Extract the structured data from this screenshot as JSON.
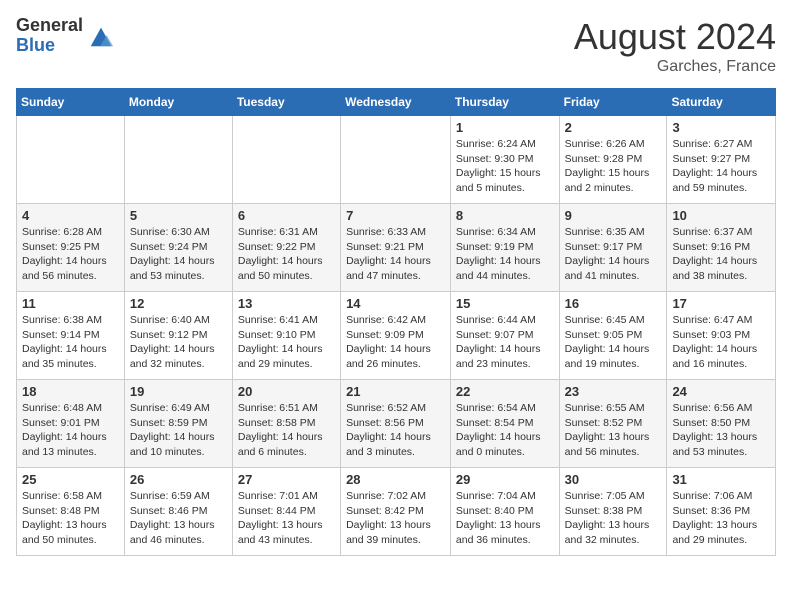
{
  "logo": {
    "general": "General",
    "blue": "Blue"
  },
  "title": "August 2024",
  "subtitle": "Garches, France",
  "days_of_week": [
    "Sunday",
    "Monday",
    "Tuesday",
    "Wednesday",
    "Thursday",
    "Friday",
    "Saturday"
  ],
  "weeks": [
    [
      {
        "day": "",
        "info": ""
      },
      {
        "day": "",
        "info": ""
      },
      {
        "day": "",
        "info": ""
      },
      {
        "day": "",
        "info": ""
      },
      {
        "day": "1",
        "info": "Sunrise: 6:24 AM\nSunset: 9:30 PM\nDaylight: 15 hours\nand 5 minutes."
      },
      {
        "day": "2",
        "info": "Sunrise: 6:26 AM\nSunset: 9:28 PM\nDaylight: 15 hours\nand 2 minutes."
      },
      {
        "day": "3",
        "info": "Sunrise: 6:27 AM\nSunset: 9:27 PM\nDaylight: 14 hours\nand 59 minutes."
      }
    ],
    [
      {
        "day": "4",
        "info": "Sunrise: 6:28 AM\nSunset: 9:25 PM\nDaylight: 14 hours\nand 56 minutes."
      },
      {
        "day": "5",
        "info": "Sunrise: 6:30 AM\nSunset: 9:24 PM\nDaylight: 14 hours\nand 53 minutes."
      },
      {
        "day": "6",
        "info": "Sunrise: 6:31 AM\nSunset: 9:22 PM\nDaylight: 14 hours\nand 50 minutes."
      },
      {
        "day": "7",
        "info": "Sunrise: 6:33 AM\nSunset: 9:21 PM\nDaylight: 14 hours\nand 47 minutes."
      },
      {
        "day": "8",
        "info": "Sunrise: 6:34 AM\nSunset: 9:19 PM\nDaylight: 14 hours\nand 44 minutes."
      },
      {
        "day": "9",
        "info": "Sunrise: 6:35 AM\nSunset: 9:17 PM\nDaylight: 14 hours\nand 41 minutes."
      },
      {
        "day": "10",
        "info": "Sunrise: 6:37 AM\nSunset: 9:16 PM\nDaylight: 14 hours\nand 38 minutes."
      }
    ],
    [
      {
        "day": "11",
        "info": "Sunrise: 6:38 AM\nSunset: 9:14 PM\nDaylight: 14 hours\nand 35 minutes."
      },
      {
        "day": "12",
        "info": "Sunrise: 6:40 AM\nSunset: 9:12 PM\nDaylight: 14 hours\nand 32 minutes."
      },
      {
        "day": "13",
        "info": "Sunrise: 6:41 AM\nSunset: 9:10 PM\nDaylight: 14 hours\nand 29 minutes."
      },
      {
        "day": "14",
        "info": "Sunrise: 6:42 AM\nSunset: 9:09 PM\nDaylight: 14 hours\nand 26 minutes."
      },
      {
        "day": "15",
        "info": "Sunrise: 6:44 AM\nSunset: 9:07 PM\nDaylight: 14 hours\nand 23 minutes."
      },
      {
        "day": "16",
        "info": "Sunrise: 6:45 AM\nSunset: 9:05 PM\nDaylight: 14 hours\nand 19 minutes."
      },
      {
        "day": "17",
        "info": "Sunrise: 6:47 AM\nSunset: 9:03 PM\nDaylight: 14 hours\nand 16 minutes."
      }
    ],
    [
      {
        "day": "18",
        "info": "Sunrise: 6:48 AM\nSunset: 9:01 PM\nDaylight: 14 hours\nand 13 minutes."
      },
      {
        "day": "19",
        "info": "Sunrise: 6:49 AM\nSunset: 8:59 PM\nDaylight: 14 hours\nand 10 minutes."
      },
      {
        "day": "20",
        "info": "Sunrise: 6:51 AM\nSunset: 8:58 PM\nDaylight: 14 hours\nand 6 minutes."
      },
      {
        "day": "21",
        "info": "Sunrise: 6:52 AM\nSunset: 8:56 PM\nDaylight: 14 hours\nand 3 minutes."
      },
      {
        "day": "22",
        "info": "Sunrise: 6:54 AM\nSunset: 8:54 PM\nDaylight: 14 hours\nand 0 minutes."
      },
      {
        "day": "23",
        "info": "Sunrise: 6:55 AM\nSunset: 8:52 PM\nDaylight: 13 hours\nand 56 minutes."
      },
      {
        "day": "24",
        "info": "Sunrise: 6:56 AM\nSunset: 8:50 PM\nDaylight: 13 hours\nand 53 minutes."
      }
    ],
    [
      {
        "day": "25",
        "info": "Sunrise: 6:58 AM\nSunset: 8:48 PM\nDaylight: 13 hours\nand 50 minutes."
      },
      {
        "day": "26",
        "info": "Sunrise: 6:59 AM\nSunset: 8:46 PM\nDaylight: 13 hours\nand 46 minutes."
      },
      {
        "day": "27",
        "info": "Sunrise: 7:01 AM\nSunset: 8:44 PM\nDaylight: 13 hours\nand 43 minutes."
      },
      {
        "day": "28",
        "info": "Sunrise: 7:02 AM\nSunset: 8:42 PM\nDaylight: 13 hours\nand 39 minutes."
      },
      {
        "day": "29",
        "info": "Sunrise: 7:04 AM\nSunset: 8:40 PM\nDaylight: 13 hours\nand 36 minutes."
      },
      {
        "day": "30",
        "info": "Sunrise: 7:05 AM\nSunset: 8:38 PM\nDaylight: 13 hours\nand 32 minutes."
      },
      {
        "day": "31",
        "info": "Sunrise: 7:06 AM\nSunset: 8:36 PM\nDaylight: 13 hours\nand 29 minutes."
      }
    ]
  ]
}
